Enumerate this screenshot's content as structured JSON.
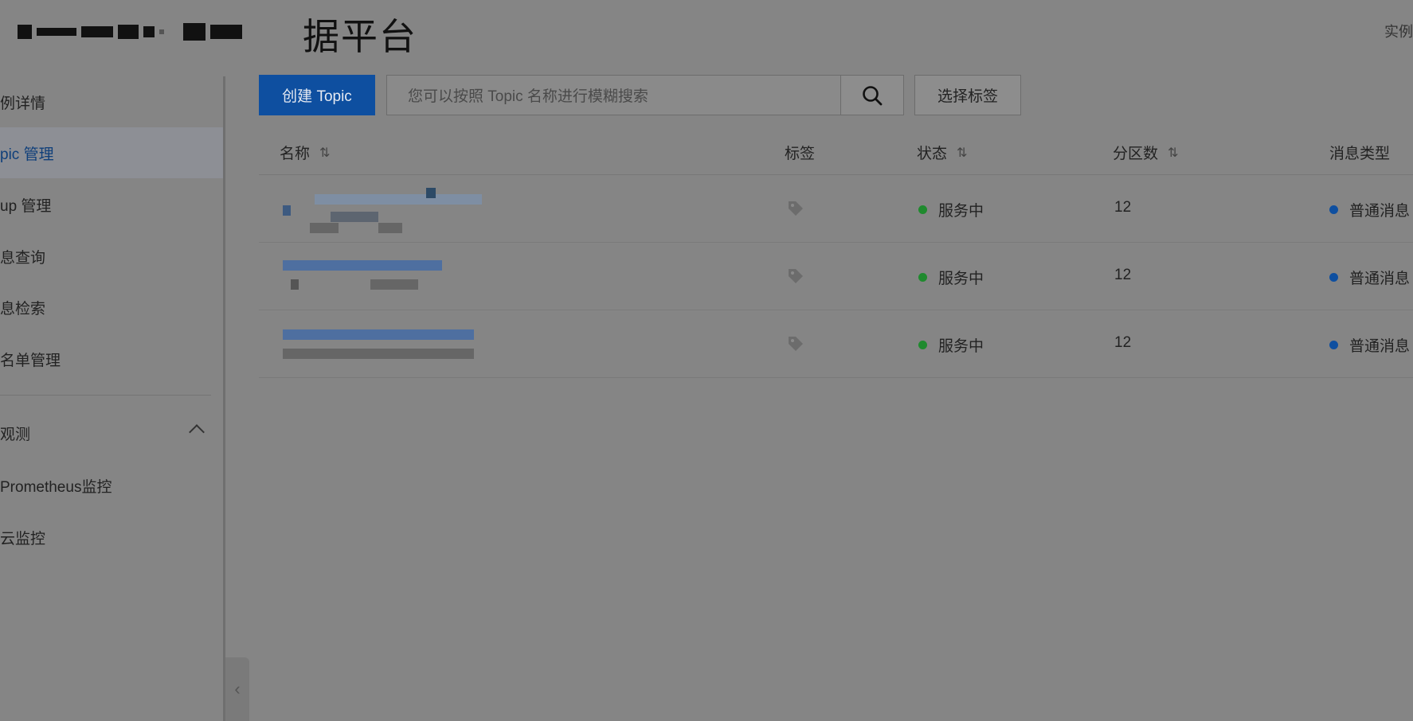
{
  "header": {
    "title_suffix": "据平台",
    "instance_link": "实例"
  },
  "sidebar": {
    "items": [
      {
        "label": "例详情"
      },
      {
        "label": "pic 管理"
      },
      {
        "label": "up 管理"
      },
      {
        "label": "息查询"
      },
      {
        "label": "息检索"
      },
      {
        "label": "名单管理"
      }
    ],
    "group": {
      "label": "观测"
    },
    "sub_items": [
      {
        "label": "Prometheus监控"
      },
      {
        "label": "云监控"
      }
    ],
    "collapse_glyph": "‹"
  },
  "toolbar": {
    "create_label": "创建 Topic",
    "search_placeholder": "您可以按照 Topic 名称进行模糊搜索",
    "tag_select_label": "选择标签"
  },
  "table": {
    "columns": [
      "名称",
      "标签",
      "状态",
      "分区数",
      "消息类型"
    ],
    "rows": [
      {
        "status": "服务中",
        "partitions": "12",
        "type": "普通消息"
      },
      {
        "status": "服务中",
        "partitions": "12",
        "type": "普通消息"
      },
      {
        "status": "服务中",
        "partitions": "12",
        "type": "普通消息"
      }
    ]
  },
  "colors": {
    "accent": "#0e4fa0",
    "status_ok": "#1f8a2e"
  }
}
